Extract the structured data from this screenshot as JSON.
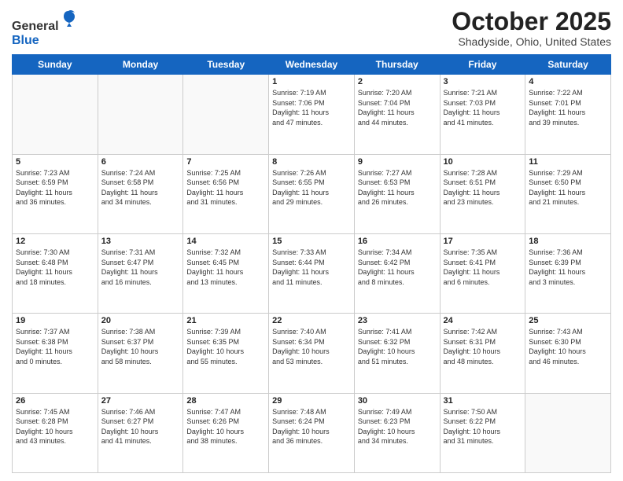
{
  "header": {
    "logo": {
      "general": "General",
      "blue": "Blue"
    },
    "title": "October 2025",
    "subtitle": "Shadyside, Ohio, United States"
  },
  "calendar": {
    "days_of_week": [
      "Sunday",
      "Monday",
      "Tuesday",
      "Wednesday",
      "Thursday",
      "Friday",
      "Saturday"
    ],
    "weeks": [
      [
        {
          "day": "",
          "info": ""
        },
        {
          "day": "",
          "info": ""
        },
        {
          "day": "",
          "info": ""
        },
        {
          "day": "1",
          "info": "Sunrise: 7:19 AM\nSunset: 7:06 PM\nDaylight: 11 hours\nand 47 minutes."
        },
        {
          "day": "2",
          "info": "Sunrise: 7:20 AM\nSunset: 7:04 PM\nDaylight: 11 hours\nand 44 minutes."
        },
        {
          "day": "3",
          "info": "Sunrise: 7:21 AM\nSunset: 7:03 PM\nDaylight: 11 hours\nand 41 minutes."
        },
        {
          "day": "4",
          "info": "Sunrise: 7:22 AM\nSunset: 7:01 PM\nDaylight: 11 hours\nand 39 minutes."
        }
      ],
      [
        {
          "day": "5",
          "info": "Sunrise: 7:23 AM\nSunset: 6:59 PM\nDaylight: 11 hours\nand 36 minutes."
        },
        {
          "day": "6",
          "info": "Sunrise: 7:24 AM\nSunset: 6:58 PM\nDaylight: 11 hours\nand 34 minutes."
        },
        {
          "day": "7",
          "info": "Sunrise: 7:25 AM\nSunset: 6:56 PM\nDaylight: 11 hours\nand 31 minutes."
        },
        {
          "day": "8",
          "info": "Sunrise: 7:26 AM\nSunset: 6:55 PM\nDaylight: 11 hours\nand 29 minutes."
        },
        {
          "day": "9",
          "info": "Sunrise: 7:27 AM\nSunset: 6:53 PM\nDaylight: 11 hours\nand 26 minutes."
        },
        {
          "day": "10",
          "info": "Sunrise: 7:28 AM\nSunset: 6:51 PM\nDaylight: 11 hours\nand 23 minutes."
        },
        {
          "day": "11",
          "info": "Sunrise: 7:29 AM\nSunset: 6:50 PM\nDaylight: 11 hours\nand 21 minutes."
        }
      ],
      [
        {
          "day": "12",
          "info": "Sunrise: 7:30 AM\nSunset: 6:48 PM\nDaylight: 11 hours\nand 18 minutes."
        },
        {
          "day": "13",
          "info": "Sunrise: 7:31 AM\nSunset: 6:47 PM\nDaylight: 11 hours\nand 16 minutes."
        },
        {
          "day": "14",
          "info": "Sunrise: 7:32 AM\nSunset: 6:45 PM\nDaylight: 11 hours\nand 13 minutes."
        },
        {
          "day": "15",
          "info": "Sunrise: 7:33 AM\nSunset: 6:44 PM\nDaylight: 11 hours\nand 11 minutes."
        },
        {
          "day": "16",
          "info": "Sunrise: 7:34 AM\nSunset: 6:42 PM\nDaylight: 11 hours\nand 8 minutes."
        },
        {
          "day": "17",
          "info": "Sunrise: 7:35 AM\nSunset: 6:41 PM\nDaylight: 11 hours\nand 6 minutes."
        },
        {
          "day": "18",
          "info": "Sunrise: 7:36 AM\nSunset: 6:39 PM\nDaylight: 11 hours\nand 3 minutes."
        }
      ],
      [
        {
          "day": "19",
          "info": "Sunrise: 7:37 AM\nSunset: 6:38 PM\nDaylight: 11 hours\nand 0 minutes."
        },
        {
          "day": "20",
          "info": "Sunrise: 7:38 AM\nSunset: 6:37 PM\nDaylight: 10 hours\nand 58 minutes."
        },
        {
          "day": "21",
          "info": "Sunrise: 7:39 AM\nSunset: 6:35 PM\nDaylight: 10 hours\nand 55 minutes."
        },
        {
          "day": "22",
          "info": "Sunrise: 7:40 AM\nSunset: 6:34 PM\nDaylight: 10 hours\nand 53 minutes."
        },
        {
          "day": "23",
          "info": "Sunrise: 7:41 AM\nSunset: 6:32 PM\nDaylight: 10 hours\nand 51 minutes."
        },
        {
          "day": "24",
          "info": "Sunrise: 7:42 AM\nSunset: 6:31 PM\nDaylight: 10 hours\nand 48 minutes."
        },
        {
          "day": "25",
          "info": "Sunrise: 7:43 AM\nSunset: 6:30 PM\nDaylight: 10 hours\nand 46 minutes."
        }
      ],
      [
        {
          "day": "26",
          "info": "Sunrise: 7:45 AM\nSunset: 6:28 PM\nDaylight: 10 hours\nand 43 minutes."
        },
        {
          "day": "27",
          "info": "Sunrise: 7:46 AM\nSunset: 6:27 PM\nDaylight: 10 hours\nand 41 minutes."
        },
        {
          "day": "28",
          "info": "Sunrise: 7:47 AM\nSunset: 6:26 PM\nDaylight: 10 hours\nand 38 minutes."
        },
        {
          "day": "29",
          "info": "Sunrise: 7:48 AM\nSunset: 6:24 PM\nDaylight: 10 hours\nand 36 minutes."
        },
        {
          "day": "30",
          "info": "Sunrise: 7:49 AM\nSunset: 6:23 PM\nDaylight: 10 hours\nand 34 minutes."
        },
        {
          "day": "31",
          "info": "Sunrise: 7:50 AM\nSunset: 6:22 PM\nDaylight: 10 hours\nand 31 minutes."
        },
        {
          "day": "",
          "info": ""
        }
      ]
    ]
  }
}
